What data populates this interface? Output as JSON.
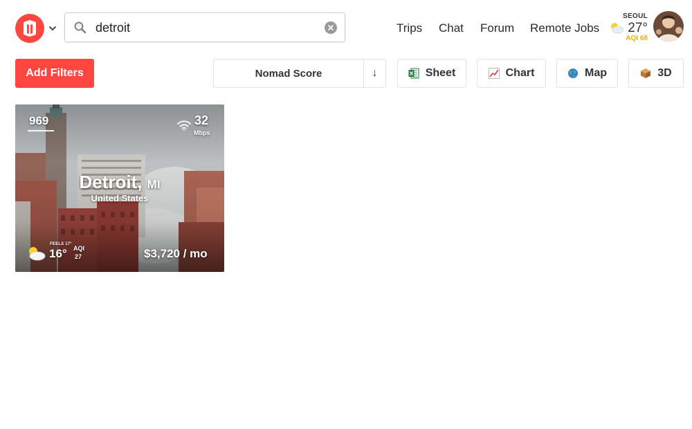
{
  "header": {
    "search": {
      "value": "detroit",
      "placeholder": ""
    },
    "nav": [
      {
        "label": "Trips"
      },
      {
        "label": "Chat"
      },
      {
        "label": "Forum"
      },
      {
        "label": "Remote Jobs"
      }
    ],
    "weather": {
      "city": "SEOUL",
      "temp": "27°",
      "aqi": "AQI 68",
      "icon": "partly-cloudy-icon"
    }
  },
  "toolbar": {
    "add_filters_label": "Add Filters",
    "sort_label": "Nomad Score",
    "sort_direction": "↓",
    "views": [
      {
        "label": "Sheet",
        "icon": "sheet-icon"
      },
      {
        "label": "Chart",
        "icon": "chart-icon"
      },
      {
        "label": "Map",
        "icon": "globe-icon"
      },
      {
        "label": "3D",
        "icon": "box-icon"
      }
    ]
  },
  "results": [
    {
      "rank": "969",
      "internet_speed": "32",
      "speed_unit": "Mbps",
      "city": "Detroit,",
      "state": "MI",
      "country": "United States",
      "feels_like": "FEELS 17°",
      "temp": "16°",
      "aqi_label": "AQI",
      "aqi": "27",
      "cost": "$3,720 / mo"
    }
  ],
  "colors": {
    "brand": "#ff4742",
    "aqi_yellow": "#e8b400"
  }
}
